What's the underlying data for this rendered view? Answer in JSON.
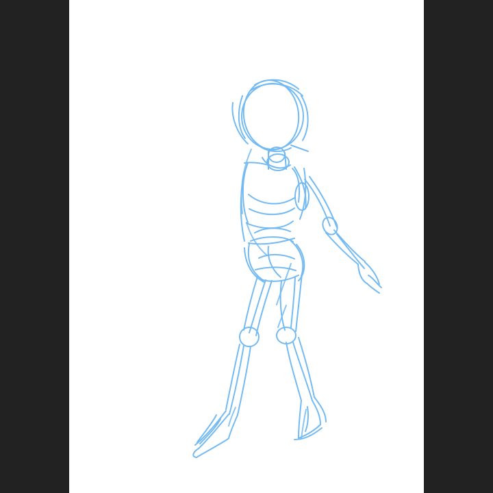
{
  "app": {
    "background_color": "#222222",
    "canvas_color": "#ffffff"
  },
  "sketch": {
    "subject": "gesture-figure-sketch",
    "stroke_color": "#8cc8f8",
    "stroke_color_dark": "#6db7f2"
  }
}
